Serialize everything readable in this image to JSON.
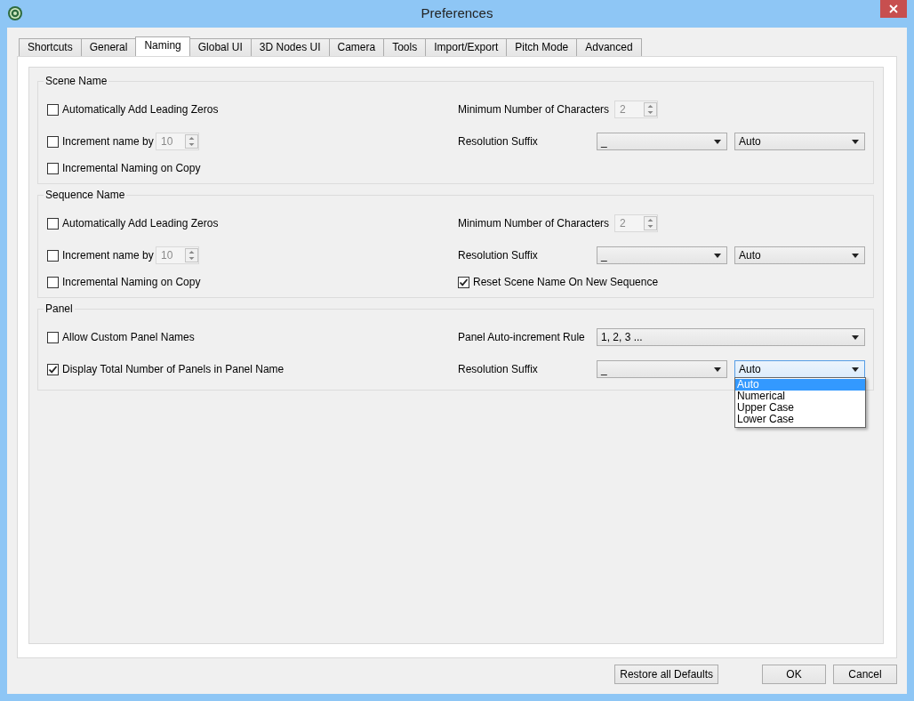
{
  "window": {
    "title": "Preferences"
  },
  "tabs": [
    {
      "label": "Shortcuts",
      "selected": false
    },
    {
      "label": "General",
      "selected": false
    },
    {
      "label": "Naming",
      "selected": true
    },
    {
      "label": "Global UI",
      "selected": false
    },
    {
      "label": "3D Nodes UI",
      "selected": false
    },
    {
      "label": "Camera",
      "selected": false
    },
    {
      "label": "Tools",
      "selected": false
    },
    {
      "label": "Import/Export",
      "selected": false
    },
    {
      "label": "Pitch Mode",
      "selected": false
    },
    {
      "label": "Advanced",
      "selected": false
    }
  ],
  "groups": [
    {
      "title": "Scene Name",
      "rows": [
        {
          "left": {
            "kind": "checkbox",
            "label": "Automatically Add Leading Zeros",
            "checked": false
          },
          "right": {
            "kind": "spin",
            "label": "Minimum Number of Characters",
            "value": "2",
            "disabled": true
          }
        },
        {
          "left": {
            "kind": "checkbox_spin",
            "label": "Increment name by",
            "checked": false,
            "value": "10",
            "disabled": true
          },
          "right": {
            "kind": "combo_pair",
            "label": "Resolution Suffix",
            "combos": [
              {
                "value": "_",
                "expanded": false
              },
              {
                "value": "Auto",
                "expanded": false
              }
            ]
          }
        },
        {
          "left": {
            "kind": "checkbox",
            "label": "Incremental Naming on Copy",
            "checked": false
          }
        }
      ]
    },
    {
      "title": "Sequence Name",
      "rows": [
        {
          "left": {
            "kind": "checkbox",
            "label": "Automatically Add Leading Zeros",
            "checked": false
          },
          "right": {
            "kind": "spin",
            "label": "Minimum Number of Characters",
            "value": "2",
            "disabled": true
          }
        },
        {
          "left": {
            "kind": "checkbox_spin",
            "label": "Increment name by",
            "checked": false,
            "value": "10",
            "disabled": true
          },
          "right": {
            "kind": "combo_pair",
            "label": "Resolution Suffix",
            "combos": [
              {
                "value": "_",
                "expanded": false
              },
              {
                "value": "Auto",
                "expanded": false
              }
            ]
          }
        },
        {
          "left": {
            "kind": "checkbox",
            "label": "Incremental Naming on Copy",
            "checked": false
          },
          "right": {
            "kind": "checkbox",
            "label": "Reset Scene Name On New Sequence",
            "checked": true
          }
        }
      ]
    },
    {
      "title": "Panel",
      "rows": [
        {
          "left": {
            "kind": "checkbox",
            "label": "Allow Custom Panel Names",
            "checked": false
          },
          "right": {
            "kind": "combo_wide",
            "label": "Panel Auto-increment Rule",
            "value": "1, 2, 3 ..."
          }
        },
        {
          "left": {
            "kind": "checkbox",
            "label": "Display Total Number of Panels in Panel Name",
            "checked": true
          },
          "right": {
            "kind": "combo_pair",
            "label": "Resolution Suffix",
            "combos": [
              {
                "value": "_",
                "expanded": false
              },
              {
                "value": "Auto",
                "expanded": true,
                "options": [
                  {
                    "label": "Auto",
                    "selected": true
                  },
                  {
                    "label": "Numerical",
                    "selected": false
                  },
                  {
                    "label": "Upper Case",
                    "selected": false
                  },
                  {
                    "label": "Lower Case",
                    "selected": false
                  }
                ]
              }
            ]
          }
        }
      ]
    }
  ],
  "buttons": [
    {
      "label": "Restore all Defaults",
      "kind": "wide"
    },
    {
      "label": "OK",
      "kind": "dialog"
    },
    {
      "label": "Cancel",
      "kind": "dialog"
    }
  ]
}
